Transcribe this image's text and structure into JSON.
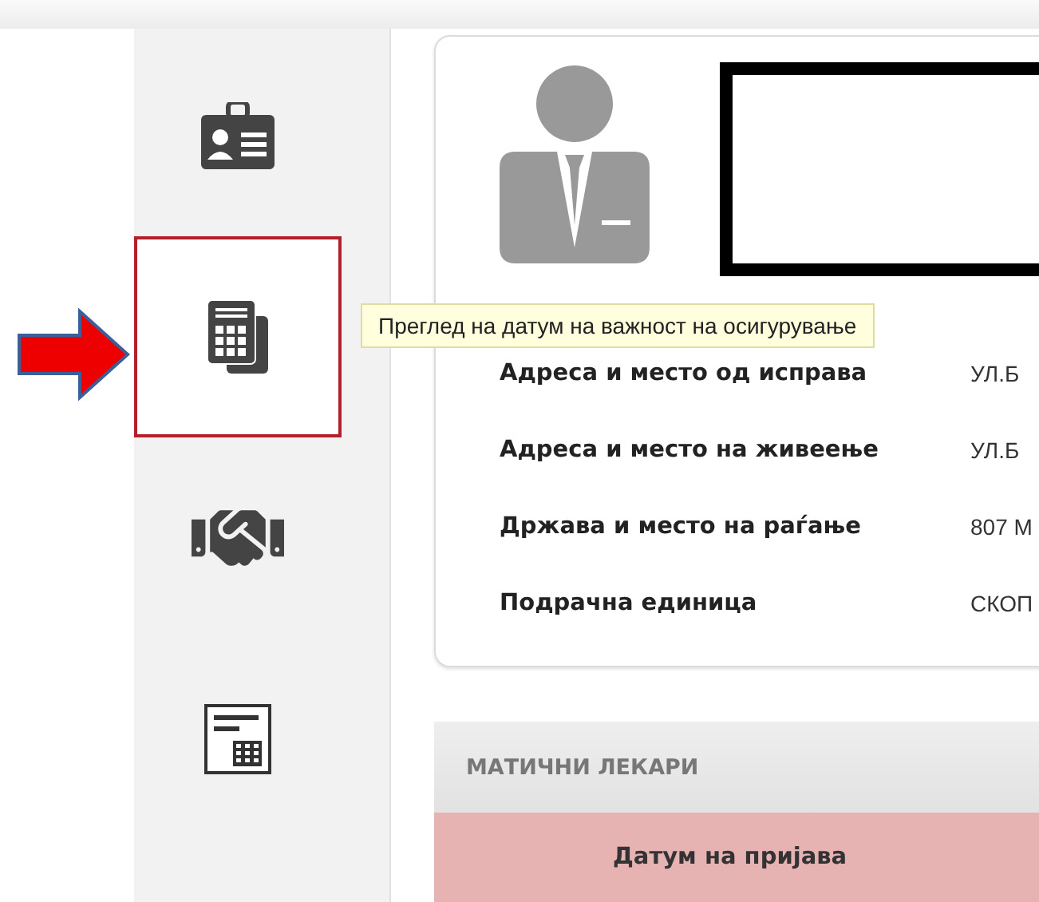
{
  "sidebar": {
    "items": [
      {
        "kind": "id-card",
        "selected": false
      },
      {
        "kind": "calculator",
        "selected": true
      },
      {
        "kind": "handshake",
        "selected": false
      },
      {
        "kind": "form",
        "selected": false
      }
    ]
  },
  "tooltip": {
    "text": "Преглед на датум на важност на осигурување"
  },
  "profile": {
    "fields": [
      {
        "label": "Адреса и место од исправа",
        "value": "УЛ.Б"
      },
      {
        "label": "Адреса и место на живеење",
        "value": "УЛ.Б"
      },
      {
        "label": "Држава и место на раѓање",
        "value": "807 М"
      },
      {
        "label": "Подрачна единица",
        "value": "СКОП"
      }
    ]
  },
  "doctors_panel": {
    "title": "МАТИЧНИ ЛЕКАРИ",
    "columns": [
      "Датум на пријава"
    ]
  }
}
